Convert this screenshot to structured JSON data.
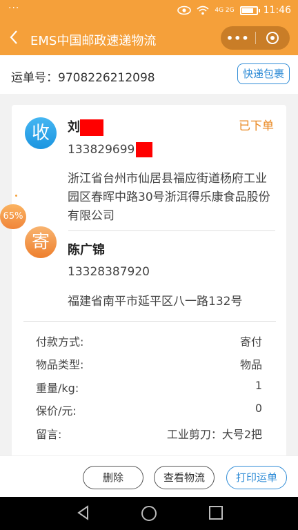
{
  "status_bar": {
    "dots": "···",
    "time": "11:46",
    "signal": "4G 2G"
  },
  "nav": {
    "title": "EMS中国邮政速递物流",
    "more": "•••"
  },
  "waybill": {
    "label": "运单号：9708226212098",
    "button": "快递包裹"
  },
  "receiver": {
    "avatar": "收",
    "name": "刘",
    "phone": "133829699",
    "address": "浙江省台州市仙居县福应街道杨府工业园区春晖中路30号浙洱得乐康食品股份有限公司"
  },
  "order_status": "已下单",
  "sender": {
    "avatar": "寄",
    "name": "陈广锦",
    "phone": "13328387920",
    "address": "福建省南平市延平区八一路132号"
  },
  "details": [
    {
      "label": "付款方式:",
      "value": "寄付"
    },
    {
      "label": "物品类型:",
      "value": "物品"
    },
    {
      "label": "重量/kg:",
      "value": "1"
    },
    {
      "label": "保价/元:",
      "value": "0"
    },
    {
      "label": "留言:",
      "value": "工业剪刀：大号2把"
    }
  ],
  "progress_badge": "65%",
  "actions": {
    "delete": "删除",
    "track": "查看物流",
    "print": "打印运单"
  },
  "colors": {
    "brand_orange": "#f5a03a",
    "accent_blue": "#2e8bd6",
    "status_orange": "#e9861e",
    "redaction": "#ff0000"
  }
}
